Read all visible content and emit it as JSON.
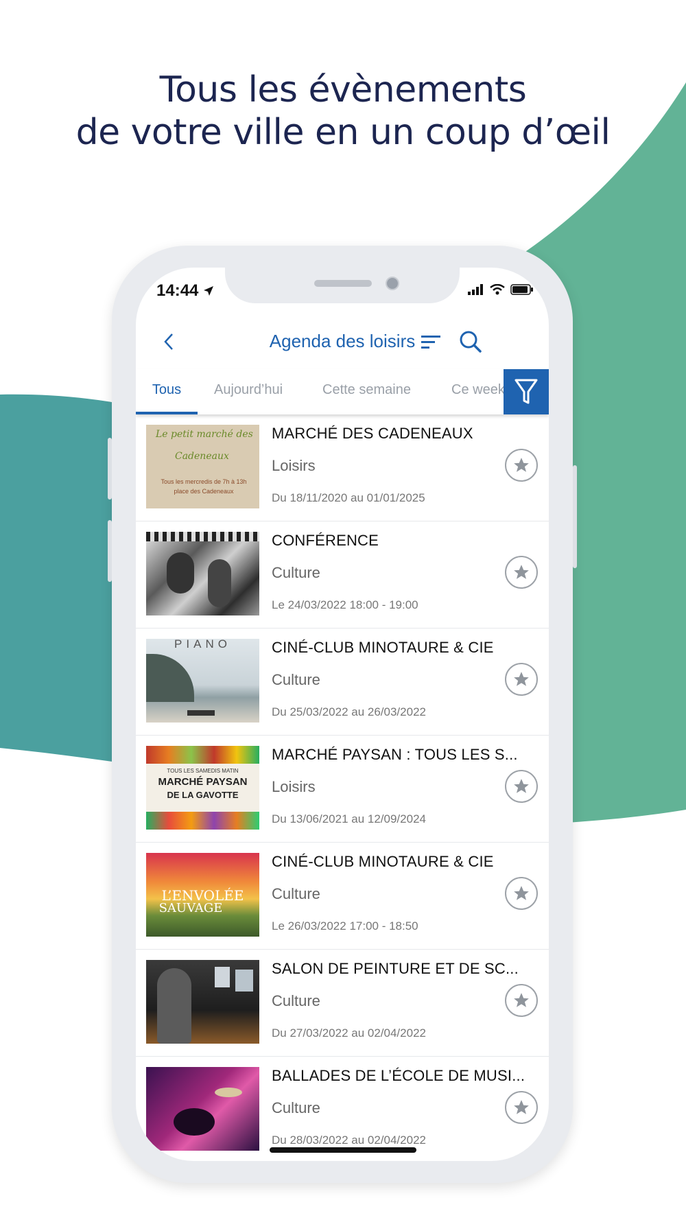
{
  "headline": {
    "line1": "Tous les évènements",
    "line2": "de votre ville en un coup d’œil"
  },
  "colors": {
    "teal": "#4ba09f",
    "green": "#62b396",
    "brand_blue": "#1f63b0",
    "headline": "#1c2550"
  },
  "status_bar": {
    "time": "14:44",
    "icons": [
      "location-arrow-icon",
      "signal-icon",
      "wifi-icon",
      "battery-icon"
    ]
  },
  "nav": {
    "title": "Agenda des loisirs",
    "back_icon": "chevron-left-icon",
    "sort_icon": "sort-icon",
    "search_icon": "search-icon"
  },
  "tabs": [
    {
      "label": "Tous",
      "active": true
    },
    {
      "label": "Aujourd’hui",
      "active": false
    },
    {
      "label": "Cette semaine",
      "active": false
    },
    {
      "label": "Ce week",
      "active": false
    }
  ],
  "filter_icon": "filter-icon",
  "events": [
    {
      "title": "MARCHÉ DES CADENEAUX",
      "category": "Loisirs",
      "date": "Du 18/11/2020 au 01/01/2025",
      "thumb": {
        "t1": "Le petit marché des",
        "t2": "Cadeneaux",
        "t3": "Tous les mercredis de 7h à 13h",
        "t4": "place des Cadeneaux"
      }
    },
    {
      "title": "CONFÉRENCE",
      "category": "Culture",
      "date": "Le 24/03/2022 18:00 - 19:00"
    },
    {
      "title": "CINÉ-CLUB MINOTAURE & CIE",
      "category": "Culture",
      "date": "Du 25/03/2022 au 26/03/2022",
      "thumb": {
        "t1": "PIANO"
      }
    },
    {
      "title": "MARCHÉ PAYSAN : TOUS LES S...",
      "category": "Loisirs",
      "date": "Du 13/06/2021 au 12/09/2024",
      "thumb": {
        "t1": "TOUS LES SAMEDIS MATIN",
        "t2": "MARCHÉ PAYSAN",
        "t3": "DE LA GAVOTTE"
      }
    },
    {
      "title": "CINÉ-CLUB MINOTAURE & CIE",
      "category": "Culture",
      "date": "Le 26/03/2022 17:00 - 18:50",
      "thumb": {
        "t1": "L’ENVOLÉE",
        "t2": "SAUVAGE"
      }
    },
    {
      "title": "SALON DE PEINTURE ET DE SC...",
      "category": "Culture",
      "date": "Du 27/03/2022 au 02/04/2022"
    },
    {
      "title": "BALLADES DE L’ÉCOLE DE MUSI...",
      "category": "Culture",
      "date": "Du 28/03/2022 au 02/04/2022"
    }
  ]
}
